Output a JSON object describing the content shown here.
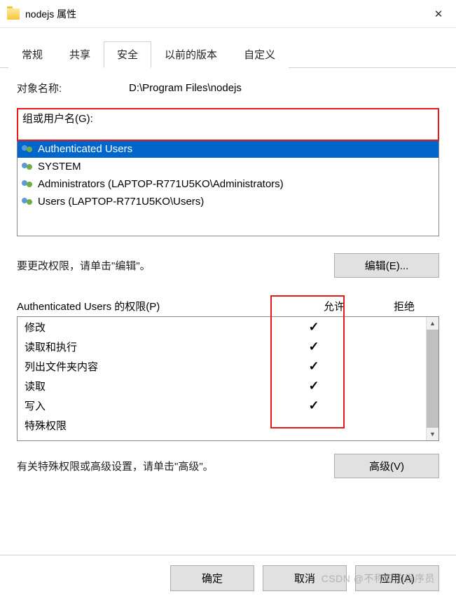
{
  "titlebar": {
    "folder_name": "nodejs",
    "title_suffix": "属性"
  },
  "tabs": [
    {
      "label": "常规",
      "active": false
    },
    {
      "label": "共享",
      "active": false
    },
    {
      "label": "安全",
      "active": true
    },
    {
      "label": "以前的版本",
      "active": false
    },
    {
      "label": "自定义",
      "active": false
    }
  ],
  "object": {
    "label": "对象名称:",
    "value": "D:\\Program Files\\nodejs"
  },
  "group_label": "组或用户名(G):",
  "users": [
    {
      "name": "Authenticated Users",
      "selected": true
    },
    {
      "name": "SYSTEM",
      "selected": false
    },
    {
      "name": "Administrators (LAPTOP-R771U5KO\\Administrators)",
      "selected": false
    },
    {
      "name": "Users (LAPTOP-R771U5KO\\Users)",
      "selected": false
    }
  ],
  "edit": {
    "hint": "要更改权限，请单击\"编辑\"。",
    "button": "编辑(E)..."
  },
  "permissions": {
    "header_for": "Authenticated Users 的权限(P)",
    "col_allow": "允许",
    "col_deny": "拒绝",
    "rows": [
      {
        "name": "修改",
        "allow": true,
        "deny": false
      },
      {
        "name": "读取和执行",
        "allow": true,
        "deny": false
      },
      {
        "name": "列出文件夹内容",
        "allow": true,
        "deny": false
      },
      {
        "name": "读取",
        "allow": true,
        "deny": false
      },
      {
        "name": "写入",
        "allow": true,
        "deny": false
      },
      {
        "name": "特殊权限",
        "allow": false,
        "deny": false
      }
    ]
  },
  "advanced": {
    "hint": "有关特殊权限或高级设置，请单击\"高级\"。",
    "button": "高级(V)"
  },
  "footer": {
    "ok": "确定",
    "cancel": "取消",
    "apply": "应用(A)"
  },
  "watermark": "CSDN @不称职的程序员"
}
